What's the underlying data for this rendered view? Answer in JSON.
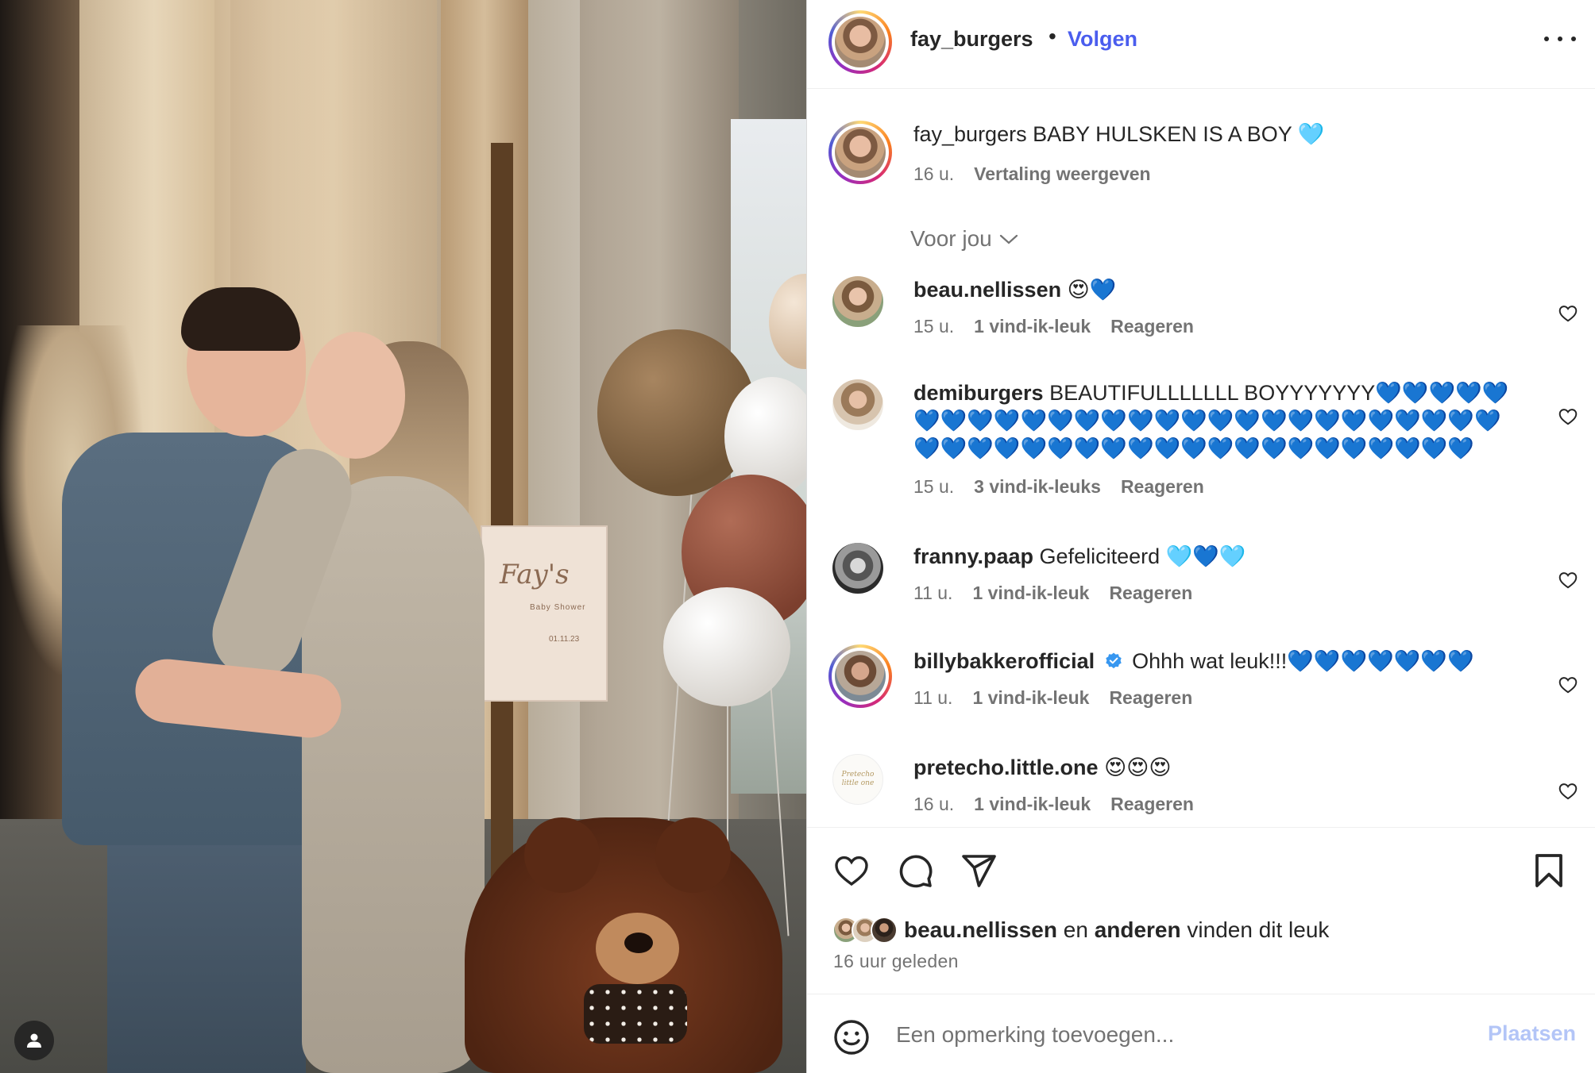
{
  "post": {
    "author": "fay_burgers",
    "separator": "•",
    "follow_label": "Volgen",
    "caption_text": "BABY HULSKEN IS A BOY 🩵",
    "caption_time": "16 u.",
    "translate_label": "Vertaling weergeven",
    "filter_label": "Voor jou"
  },
  "comments": [
    {
      "user": "beau.nellissen",
      "text": "😍💙",
      "time": "15 u.",
      "likes": "1 vind-ik-leuk",
      "reply": "Reageren"
    },
    {
      "user": "demiburgers",
      "text": "BEAUTIFULLLLLLL BOYYYYYYY💙💙💙💙💙💙💙💙💙💙💙💙💙💙💙💙💙💙💙💙💙💙💙💙💙💙💙💙💙💙💙💙💙💙💙💙💙💙💙💙💙💙💙💙💙💙💙💙",
      "time": "15 u.",
      "likes": "3 vind-ik-leuks",
      "reply": "Reageren"
    },
    {
      "user": "franny.paap",
      "text": "Gefeliciteerd 🩵💙🩵",
      "time": "11 u.",
      "likes": "1 vind-ik-leuk",
      "reply": "Reageren"
    },
    {
      "user": "billybakkerofficial",
      "text": "Ohhh wat leuk!!!💙💙💙💙💙💙💙",
      "time": "11 u.",
      "likes": "1 vind-ik-leuk",
      "reply": "Reageren",
      "verified": true
    },
    {
      "user": "pretecho.little.one",
      "text": "😍😍😍",
      "time": "16 u.",
      "likes": "1 vind-ik-leuk",
      "reply": "Reageren",
      "avatar_text": "Pretecho little one"
    }
  ],
  "likes_line": {
    "first_user": "beau.nellissen",
    "connector": "en",
    "others": "anderen",
    "suffix": "vinden dit leuk"
  },
  "time_ago": "16 uur geleden",
  "add_comment": {
    "placeholder": "Een opmerking toevoegen...",
    "post_label": "Plaatsen"
  },
  "icons": {
    "more": "more-options-icon",
    "like": "heart-icon",
    "comment": "comment-icon",
    "share": "paper-plane-icon",
    "save": "bookmark-icon",
    "emoji": "smiley-icon",
    "tag": "user-tag-icon",
    "verified": "verified-badge-icon"
  },
  "colors": {
    "link_blue": "#4a5dee",
    "verified_blue": "#3797f0",
    "post_disabled": "#b3c5f7",
    "muted_text": "#737373"
  }
}
